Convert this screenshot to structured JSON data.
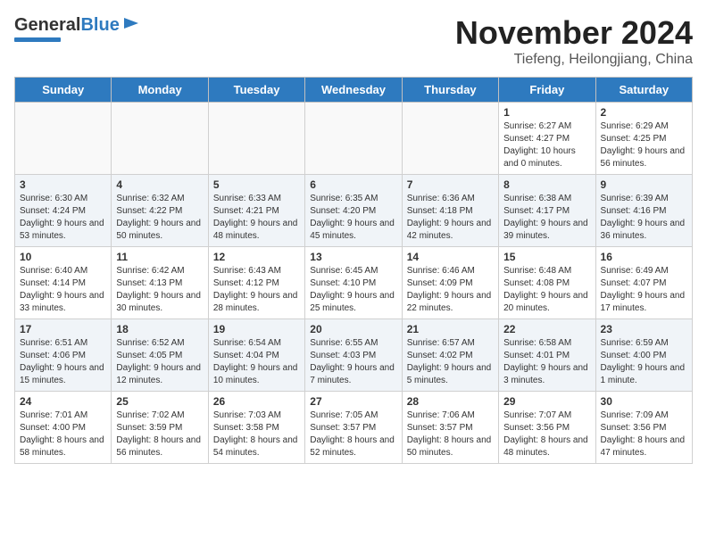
{
  "header": {
    "logo_general": "General",
    "logo_blue": "Blue",
    "month_year": "November 2024",
    "location": "Tiefeng, Heilongjiang, China"
  },
  "weekdays": [
    "Sunday",
    "Monday",
    "Tuesday",
    "Wednesday",
    "Thursday",
    "Friday",
    "Saturday"
  ],
  "weeks": [
    [
      {
        "day": "",
        "info": ""
      },
      {
        "day": "",
        "info": ""
      },
      {
        "day": "",
        "info": ""
      },
      {
        "day": "",
        "info": ""
      },
      {
        "day": "",
        "info": ""
      },
      {
        "day": "1",
        "info": "Sunrise: 6:27 AM\nSunset: 4:27 PM\nDaylight: 10 hours and 0 minutes."
      },
      {
        "day": "2",
        "info": "Sunrise: 6:29 AM\nSunset: 4:25 PM\nDaylight: 9 hours and 56 minutes."
      }
    ],
    [
      {
        "day": "3",
        "info": "Sunrise: 6:30 AM\nSunset: 4:24 PM\nDaylight: 9 hours and 53 minutes."
      },
      {
        "day": "4",
        "info": "Sunrise: 6:32 AM\nSunset: 4:22 PM\nDaylight: 9 hours and 50 minutes."
      },
      {
        "day": "5",
        "info": "Sunrise: 6:33 AM\nSunset: 4:21 PM\nDaylight: 9 hours and 48 minutes."
      },
      {
        "day": "6",
        "info": "Sunrise: 6:35 AM\nSunset: 4:20 PM\nDaylight: 9 hours and 45 minutes."
      },
      {
        "day": "7",
        "info": "Sunrise: 6:36 AM\nSunset: 4:18 PM\nDaylight: 9 hours and 42 minutes."
      },
      {
        "day": "8",
        "info": "Sunrise: 6:38 AM\nSunset: 4:17 PM\nDaylight: 9 hours and 39 minutes."
      },
      {
        "day": "9",
        "info": "Sunrise: 6:39 AM\nSunset: 4:16 PM\nDaylight: 9 hours and 36 minutes."
      }
    ],
    [
      {
        "day": "10",
        "info": "Sunrise: 6:40 AM\nSunset: 4:14 PM\nDaylight: 9 hours and 33 minutes."
      },
      {
        "day": "11",
        "info": "Sunrise: 6:42 AM\nSunset: 4:13 PM\nDaylight: 9 hours and 30 minutes."
      },
      {
        "day": "12",
        "info": "Sunrise: 6:43 AM\nSunset: 4:12 PM\nDaylight: 9 hours and 28 minutes."
      },
      {
        "day": "13",
        "info": "Sunrise: 6:45 AM\nSunset: 4:10 PM\nDaylight: 9 hours and 25 minutes."
      },
      {
        "day": "14",
        "info": "Sunrise: 6:46 AM\nSunset: 4:09 PM\nDaylight: 9 hours and 22 minutes."
      },
      {
        "day": "15",
        "info": "Sunrise: 6:48 AM\nSunset: 4:08 PM\nDaylight: 9 hours and 20 minutes."
      },
      {
        "day": "16",
        "info": "Sunrise: 6:49 AM\nSunset: 4:07 PM\nDaylight: 9 hours and 17 minutes."
      }
    ],
    [
      {
        "day": "17",
        "info": "Sunrise: 6:51 AM\nSunset: 4:06 PM\nDaylight: 9 hours and 15 minutes."
      },
      {
        "day": "18",
        "info": "Sunrise: 6:52 AM\nSunset: 4:05 PM\nDaylight: 9 hours and 12 minutes."
      },
      {
        "day": "19",
        "info": "Sunrise: 6:54 AM\nSunset: 4:04 PM\nDaylight: 9 hours and 10 minutes."
      },
      {
        "day": "20",
        "info": "Sunrise: 6:55 AM\nSunset: 4:03 PM\nDaylight: 9 hours and 7 minutes."
      },
      {
        "day": "21",
        "info": "Sunrise: 6:57 AM\nSunset: 4:02 PM\nDaylight: 9 hours and 5 minutes."
      },
      {
        "day": "22",
        "info": "Sunrise: 6:58 AM\nSunset: 4:01 PM\nDaylight: 9 hours and 3 minutes."
      },
      {
        "day": "23",
        "info": "Sunrise: 6:59 AM\nSunset: 4:00 PM\nDaylight: 9 hours and 1 minute."
      }
    ],
    [
      {
        "day": "24",
        "info": "Sunrise: 7:01 AM\nSunset: 4:00 PM\nDaylight: 8 hours and 58 minutes."
      },
      {
        "day": "25",
        "info": "Sunrise: 7:02 AM\nSunset: 3:59 PM\nDaylight: 8 hours and 56 minutes."
      },
      {
        "day": "26",
        "info": "Sunrise: 7:03 AM\nSunset: 3:58 PM\nDaylight: 8 hours and 54 minutes."
      },
      {
        "day": "27",
        "info": "Sunrise: 7:05 AM\nSunset: 3:57 PM\nDaylight: 8 hours and 52 minutes."
      },
      {
        "day": "28",
        "info": "Sunrise: 7:06 AM\nSunset: 3:57 PM\nDaylight: 8 hours and 50 minutes."
      },
      {
        "day": "29",
        "info": "Sunrise: 7:07 AM\nSunset: 3:56 PM\nDaylight: 8 hours and 48 minutes."
      },
      {
        "day": "30",
        "info": "Sunrise: 7:09 AM\nSunset: 3:56 PM\nDaylight: 8 hours and 47 minutes."
      }
    ]
  ]
}
